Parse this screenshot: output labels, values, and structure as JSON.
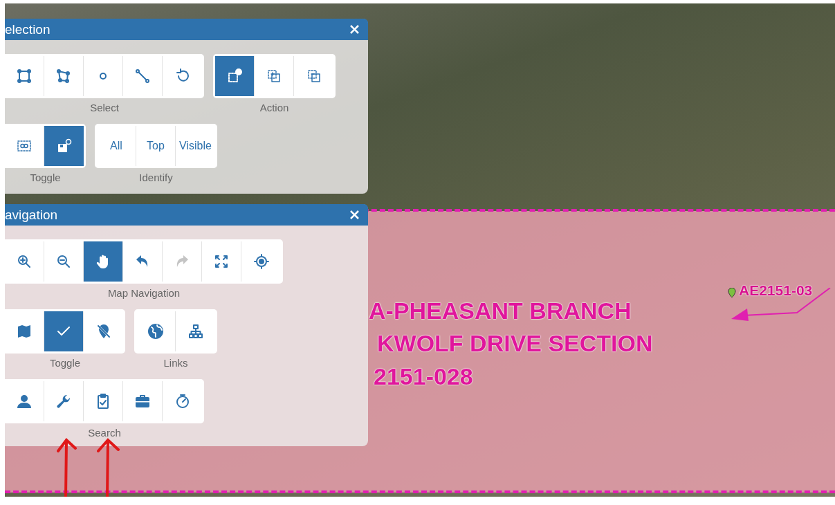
{
  "panels": [
    {
      "title": "election",
      "rows": [
        {
          "groups": [
            {
              "label": "Select",
              "buttons": [
                {
                  "kind": "icon",
                  "selected": false,
                  "disabled": false
                },
                {
                  "kind": "icon",
                  "selected": false,
                  "disabled": false
                },
                {
                  "kind": "icon",
                  "selected": false,
                  "disabled": false
                },
                {
                  "kind": "icon",
                  "selected": false,
                  "disabled": false
                },
                {
                  "kind": "icon",
                  "selected": false,
                  "disabled": false
                }
              ]
            },
            {
              "label": "Action",
              "buttons": [
                {
                  "kind": "icon",
                  "selected": true,
                  "disabled": false
                },
                {
                  "kind": "icon",
                  "selected": false,
                  "disabled": false
                },
                {
                  "kind": "icon",
                  "selected": false,
                  "disabled": false
                }
              ]
            }
          ]
        },
        {
          "groups": [
            {
              "label": "Toggle",
              "buttons": [
                {
                  "kind": "icon",
                  "selected": false,
                  "disabled": false
                },
                {
                  "kind": "icon",
                  "selected": true,
                  "disabled": false
                }
              ]
            },
            {
              "label": "Identify",
              "buttons": [
                {
                  "kind": "text",
                  "text": "All",
                  "selected": false,
                  "disabled": false
                },
                {
                  "kind": "text",
                  "text": "Top",
                  "selected": false,
                  "disabled": false
                },
                {
                  "kind": "text",
                  "text": "Visible",
                  "selected": false,
                  "disabled": false
                }
              ]
            }
          ]
        }
      ]
    },
    {
      "title": "avigation",
      "rows": [
        {
          "groups": [
            {
              "label": "Map Navigation",
              "buttons": [
                {
                  "kind": "icon",
                  "selected": false,
                  "disabled": false
                },
                {
                  "kind": "icon",
                  "selected": false,
                  "disabled": false
                },
                {
                  "kind": "icon",
                  "selected": true,
                  "disabled": false
                },
                {
                  "kind": "icon",
                  "selected": false,
                  "disabled": false
                },
                {
                  "kind": "icon",
                  "selected": false,
                  "disabled": true
                },
                {
                  "kind": "icon",
                  "selected": false,
                  "disabled": false
                },
                {
                  "kind": "icon",
                  "selected": false,
                  "disabled": false
                }
              ]
            }
          ]
        },
        {
          "groups": [
            {
              "label": "Toggle",
              "buttons": [
                {
                  "kind": "icon",
                  "selected": false,
                  "disabled": false
                },
                {
                  "kind": "icon",
                  "selected": true,
                  "disabled": false
                },
                {
                  "kind": "icon",
                  "selected": false,
                  "disabled": false
                }
              ]
            },
            {
              "label": "Links",
              "buttons": [
                {
                  "kind": "icon",
                  "selected": false,
                  "disabled": false
                },
                {
                  "kind": "icon",
                  "selected": false,
                  "disabled": false
                }
              ]
            }
          ]
        },
        {
          "groups": [
            {
              "label": "Search",
              "buttons": [
                {
                  "kind": "icon",
                  "selected": false,
                  "disabled": false
                },
                {
                  "kind": "icon",
                  "selected": false,
                  "disabled": false
                },
                {
                  "kind": "icon",
                  "selected": false,
                  "disabled": false
                },
                {
                  "kind": "icon",
                  "selected": false,
                  "disabled": false
                },
                {
                  "kind": "icon",
                  "selected": false,
                  "disabled": false
                }
              ]
            }
          ]
        }
      ]
    }
  ],
  "map": {
    "area_label": [
      "A-PHEASANT BRANCH",
      "KWOLF DRIVE SECTION",
      "2151-028"
    ],
    "point_label": "AE2151-03"
  }
}
